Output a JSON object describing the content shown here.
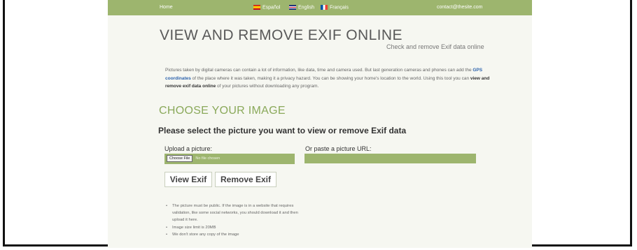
{
  "nav": {
    "home": "Home",
    "lang_es": "Español",
    "lang_en": "English",
    "lang_fr": "Français",
    "contact": "contact@thesite.com"
  },
  "header": {
    "title": "VIEW AND REMOVE EXIF ONLINE",
    "subtitle": "Check and remove Exif data online"
  },
  "intro": {
    "part1": "Pictures taken by digital cameras can contain a lot of information, like data, time and camera used. But last generation cameras and phones can add the ",
    "gps_link": "GPS coordinates",
    "part2": " of the place where it was taken, making it a privacy hazard. You can be showing your home's location to the world. Using this tool you can ",
    "bold": "view and remove exif data online",
    "part3": " of your pictures without downloading any program."
  },
  "section": {
    "heading": "CHOOSE YOUR IMAGE",
    "prompt": "Please select the picture you want to view or remove Exif data"
  },
  "upload": {
    "label": "Upload a picture:",
    "button_label": "Choose File",
    "status": "No file chosen"
  },
  "url": {
    "label": "Or paste a picture URL:",
    "value": "",
    "placeholder": ""
  },
  "actions": {
    "view": "View Exif",
    "remove": "Remove Exif"
  },
  "notes": [
    "The picture must be public. If the image is in a website that requires validation, like some social networks, you should download it and then upload it here.",
    "Image size limit is 20MB",
    "We don't store any copy of the image"
  ],
  "colors": {
    "accent": "#9db56e",
    "heading_green": "#8aa95a",
    "page_bg": "#f6f7f1",
    "link": "#2d63ad"
  }
}
